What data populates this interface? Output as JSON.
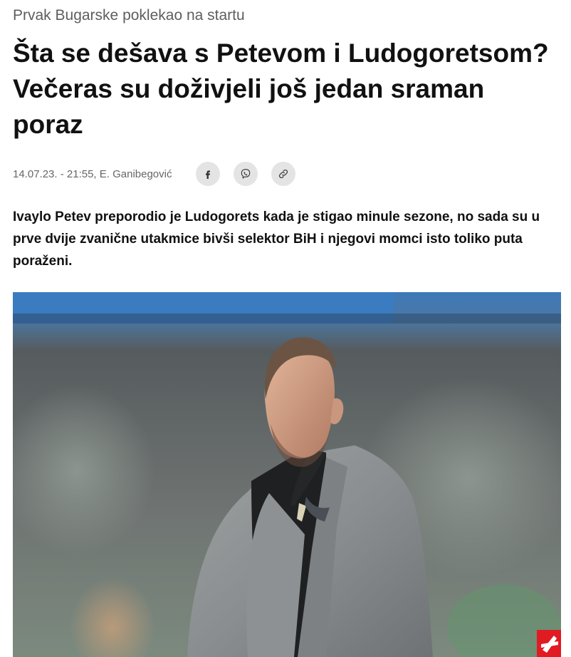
{
  "article": {
    "kicker": "Prvak Bugarske poklekao na startu",
    "headline": "Šta se dešava s Petevom i Ludogoretsom? Večeras su doživjeli još jedan sraman poraz",
    "meta": "14.07.23. - 21:55, E. Ganibegović",
    "lead": "Ivaylo Petev preporodio je Ludogorets kada je stigao minule sezone, no sada su u prve dvije zvanične utakmice bivši selektor BiH i njegovi momci isto toliko puta poraženi."
  },
  "share": {
    "icons": [
      "facebook-icon",
      "viber-icon",
      "link-icon"
    ],
    "button_color": "#e4e4e4"
  },
  "photo": {
    "logo_color": "#e11b22"
  }
}
